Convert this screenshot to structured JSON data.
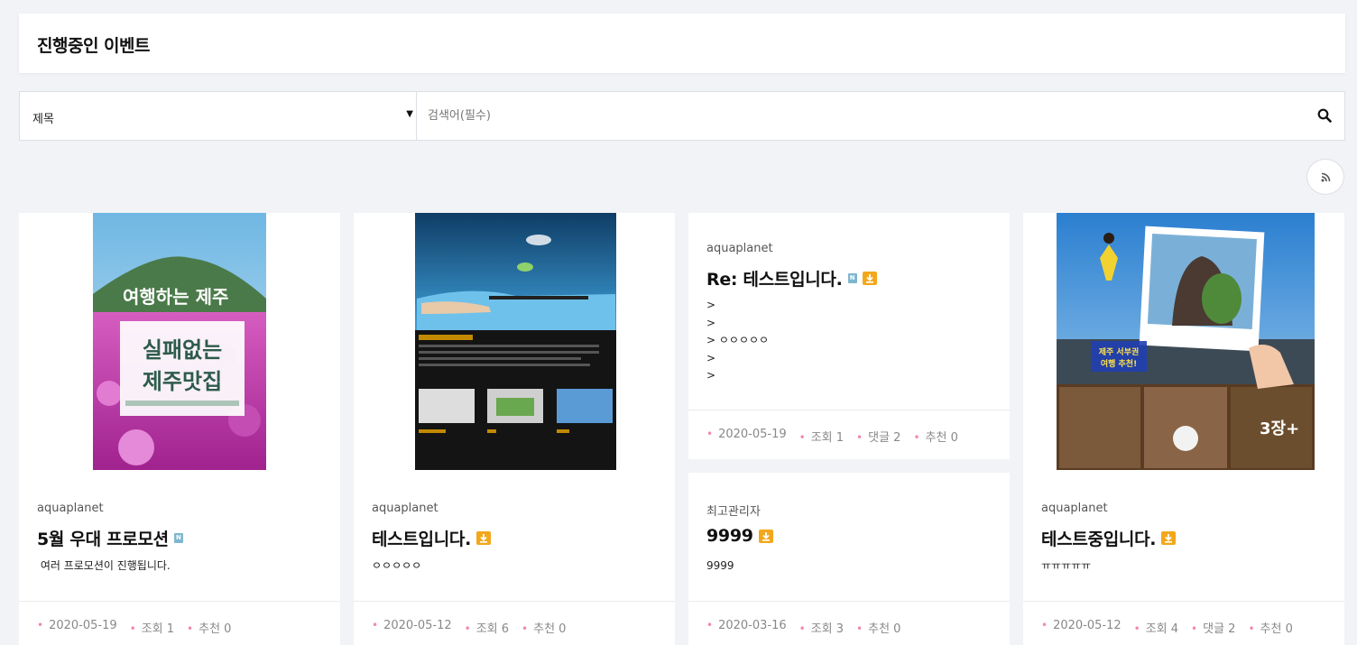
{
  "page": {
    "title": "진행중인 이벤트"
  },
  "search": {
    "field_selected": "제목",
    "placeholder": "검색어(필수)"
  },
  "icons": {
    "search": "search-icon",
    "rss": "rss-icon",
    "new": "new-badge-icon",
    "download": "download-icon"
  },
  "colors": {
    "accent_dot": "#f28aa3",
    "download_badge": "#f2a81c",
    "new_badge": "#7fb6cf"
  },
  "cards": [
    {
      "author": "aquaplanet",
      "title": "5월 우대 프로모션",
      "excerpt": " 여러 프로모션이 진행됩니다.",
      "thumb_title": "여행하는 제주",
      "thumb_main": "실패없는\n제주맛집",
      "date": "2020-05-19",
      "views": "조회 1",
      "likes": "추천 0"
    },
    {
      "author": "aquaplanet",
      "title": "테스트입니다.",
      "excerpt": "ㅇㅇㅇㅇㅇ",
      "date": "2020-05-12",
      "views": "조회 6",
      "likes": "추천 0"
    },
    {
      "author": "aquaplanet",
      "title": "Re: 테스트입니다.",
      "excerpt": ">\n>\n> ㅇㅇㅇㅇㅇ\n>\n>",
      "date": "2020-05-19",
      "views": "조회 1",
      "comments": "댓글 2",
      "likes": "추천 0"
    },
    {
      "author": "최고관리자",
      "title": "9999",
      "excerpt": "9999",
      "date": "2020-03-16",
      "views": "조회 3",
      "likes": "추천 0"
    },
    {
      "author": "aquaplanet",
      "title": "테스트중입니다.",
      "excerpt": "ㅠㅠㅠㅠㅠ",
      "thumb_caption": "제주 서부권\n여행 추천!",
      "thumb_badge": "3장+",
      "date": "2020-05-12",
      "views": "조회 4",
      "comments": "댓글 2",
      "likes": "추천 0"
    }
  ]
}
